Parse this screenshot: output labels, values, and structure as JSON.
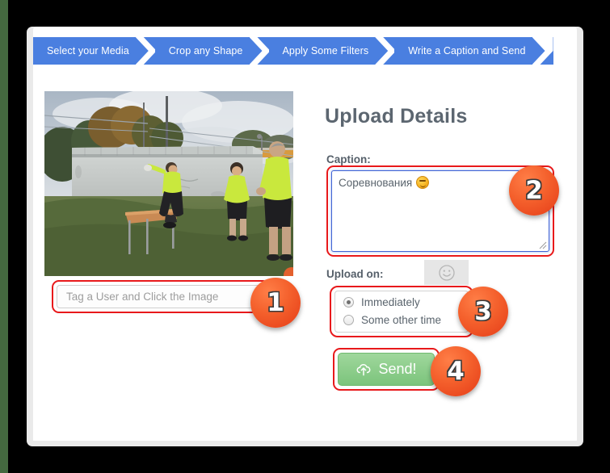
{
  "window": {
    "background_color": "#000000",
    "left_strip_color": "#44693f",
    "panel_color": "#eaeaea",
    "sheet_color": "#ffffff"
  },
  "wizard": {
    "accent_color": "#4a7fe0",
    "steps": [
      {
        "label": "Select your Media"
      },
      {
        "label": "Crop any Shape"
      },
      {
        "label": "Apply Some Filters"
      },
      {
        "label": "Write a Caption and Send"
      }
    ]
  },
  "media": {
    "alt": "photo of athletes in yellow shirts jumping over a table on grass in front of a concrete wall",
    "tag_input": {
      "value": "",
      "placeholder": "Tag a User and Click the Image"
    }
  },
  "details": {
    "title": "Upload Details",
    "caption_label": "Caption:",
    "caption_value": "Соревнования",
    "caption_emoji": "smiley-face-emoji",
    "caption_placeholder": "",
    "emoji_button_icon": "smiley-icon",
    "upload_on_label": "Upload on:",
    "schedule_options": [
      {
        "label": "Immediately",
        "selected": true
      },
      {
        "label": "Some other time",
        "selected": false
      }
    ],
    "send_button": {
      "label": "Send!",
      "icon": "cloud-upload-icon",
      "color": "#7cc47c"
    },
    "resize_handle_icon": "resize-grip-icon"
  },
  "annotations": {
    "highlight_color": "#e8191b",
    "badge_color": "#f4602c",
    "badges": [
      {
        "number": "1",
        "target": "tag-input"
      },
      {
        "number": "2",
        "target": "caption-textarea"
      },
      {
        "number": "3",
        "target": "schedule-radio-group"
      },
      {
        "number": "4",
        "target": "send-button"
      }
    ]
  }
}
